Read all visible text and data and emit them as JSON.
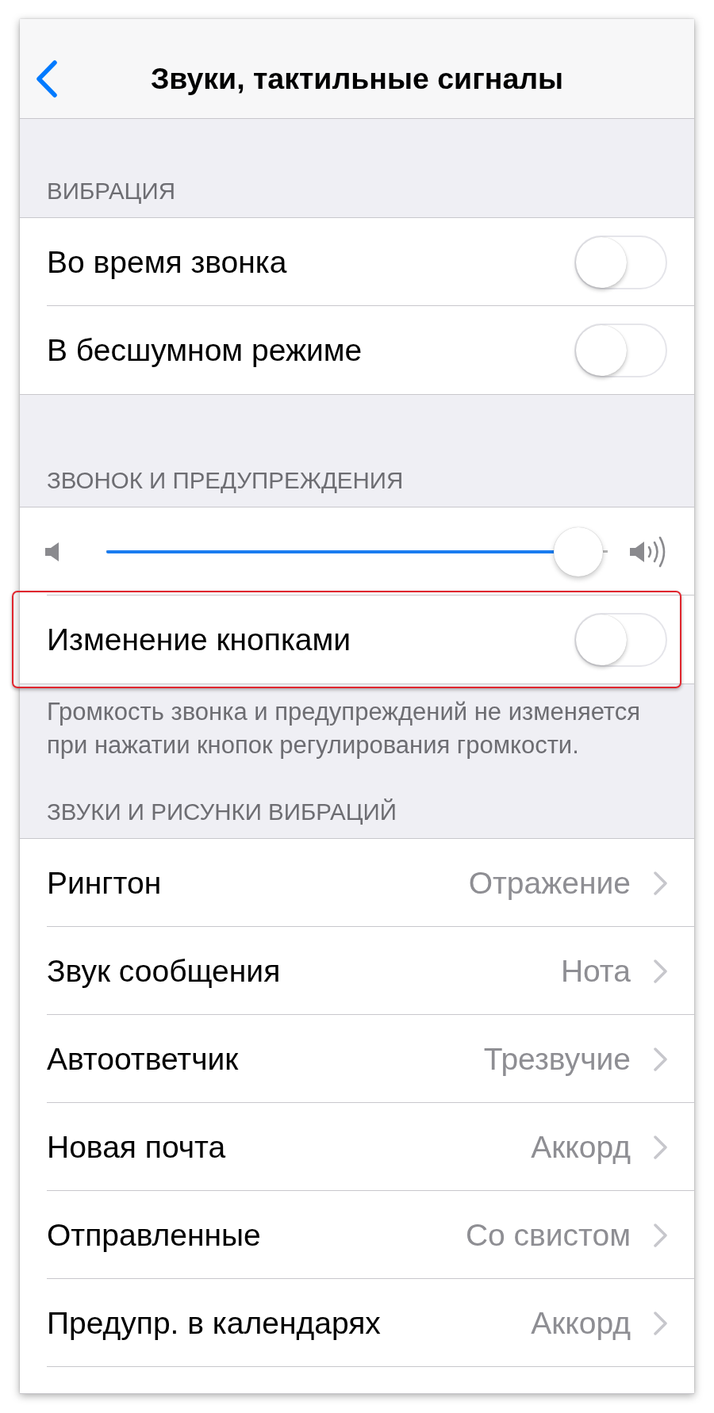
{
  "nav_bar": {
    "title": "Звуки, тактильные сигналы"
  },
  "sections": [
    {
      "header": "ВИБРАЦИЯ",
      "rows": [
        {
          "kind": "toggle",
          "label": "Во время звонка",
          "on": false,
          "highlighted": false
        },
        {
          "kind": "toggle",
          "label": "В бесшумном режиме",
          "on": false,
          "highlighted": false
        }
      ]
    },
    {
      "header": "ЗВОНОК И ПРЕДУПРЕЖДЕНИЯ",
      "rows": [
        {
          "kind": "slider",
          "level": 0.99,
          "highlighted": false
        },
        {
          "kind": "toggle",
          "label": "Изменение кнопками",
          "on": false,
          "highlighted": true
        }
      ],
      "footer": "Громкость звонка и предупреждений не изменяется при нажатии кнопок регулирования громкости."
    },
    {
      "header": "ЗВУКИ И РИСУНКИ ВИБРАЦИЙ",
      "rows": [
        {
          "kind": "link",
          "label": "Рингтон",
          "value": "Отражение",
          "highlighted": false
        },
        {
          "kind": "link",
          "label": "Звук сообщения",
          "value": "Нота",
          "highlighted": false
        },
        {
          "kind": "link",
          "label": "Автоответчик",
          "value": "Трезвучие",
          "highlighted": false
        },
        {
          "kind": "link",
          "label": "Новая почта",
          "value": "Аккорд",
          "highlighted": false
        },
        {
          "kind": "link",
          "label": "Отправленные",
          "value": "Со свистом",
          "highlighted": false
        },
        {
          "kind": "link",
          "label": "Предупр. в календарях",
          "value": "Аккорд",
          "highlighted": false
        }
      ]
    }
  ]
}
